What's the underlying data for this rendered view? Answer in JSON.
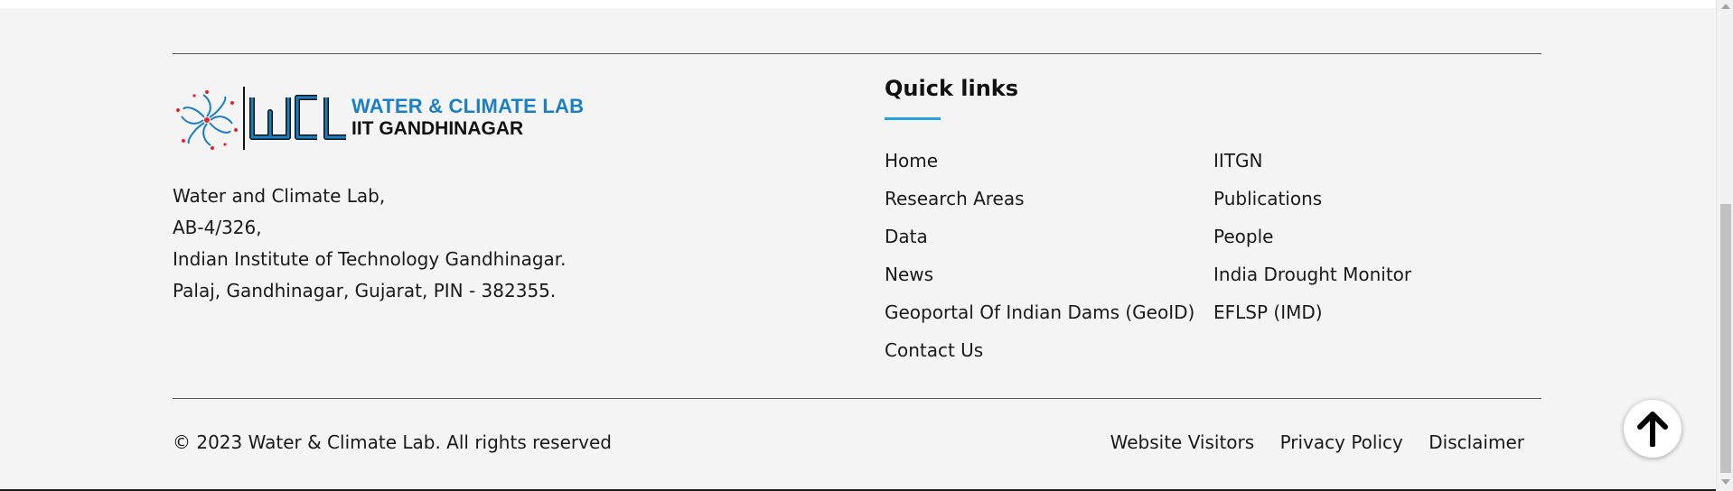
{
  "logo": {
    "monogram": "WCL",
    "title": "WATER & CLIMATE LAB",
    "subtitle": "IIT GANDHINAGAR",
    "accent_color": "#1b7fc4"
  },
  "address": {
    "lines": [
      "Water and Climate Lab,",
      "AB-4/326,",
      "Indian Institute of Technology Gandhinagar.",
      "Palaj, Gandhinagar, Gujarat, PIN - 382355."
    ]
  },
  "quick_links": {
    "title": "Quick links",
    "underline_color": "#1ea3dc",
    "left": [
      "Home",
      "Research Areas",
      "Data",
      "News",
      "Geoportal Of Indian Dams (GeoID)",
      "Contact Us"
    ],
    "right": [
      "IITGN",
      "Publications",
      "People",
      "India Drought Monitor",
      "EFLSP (IMD)"
    ]
  },
  "bottom": {
    "copyright": "© 2023 Water & Climate Lab. All rights reserved",
    "links": [
      "Website Visitors",
      "Privacy Policy",
      "Disclaimer"
    ]
  },
  "back_to_top": {
    "icon": "arrow-up-icon"
  }
}
